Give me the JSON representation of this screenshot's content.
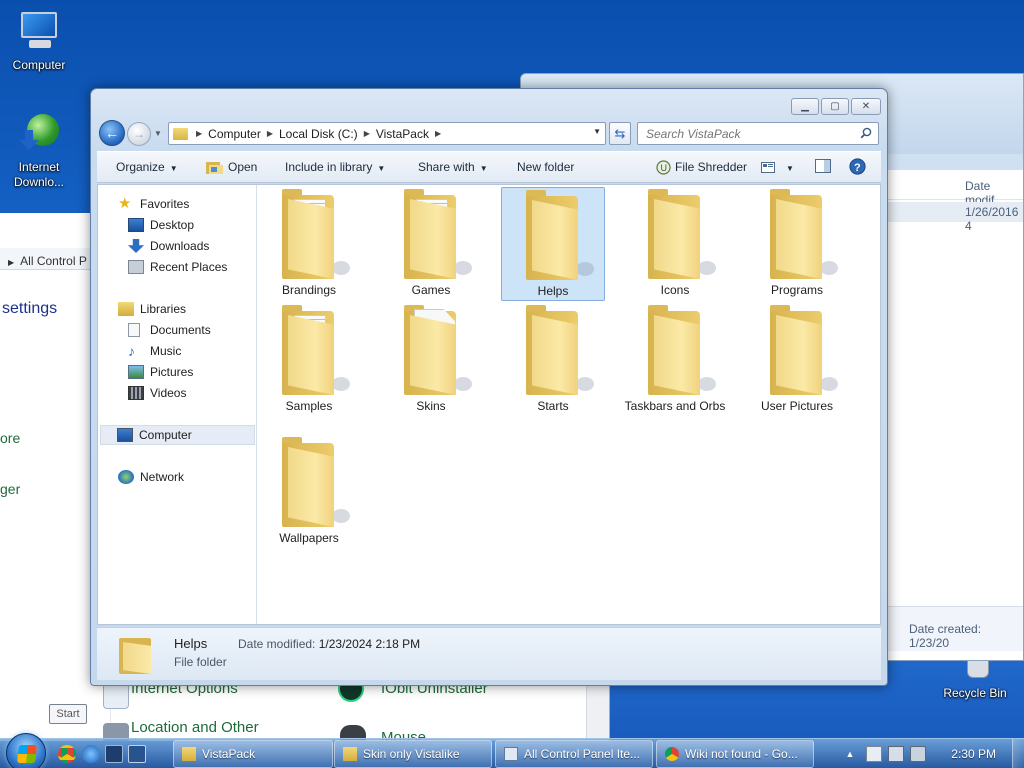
{
  "desktop": {
    "icons": [
      {
        "label": "Computer"
      },
      {
        "label": "Internet Downlo..."
      },
      {
        "label": "Recycle Bin"
      }
    ]
  },
  "control_panel": {
    "address_text": "All Control P",
    "settings_heading": "settings",
    "side_links": [
      "ore",
      "ger"
    ],
    "items": [
      "Internet Options",
      "IObit Uninstaller",
      "Location and Other",
      "Mouse"
    ]
  },
  "bg_window": {
    "column_header": "Date modif",
    "row_value": "1/26/2016 4",
    "footer_text": "Date created: 1/23/20"
  },
  "explorer": {
    "breadcrumbs": [
      "Computer",
      "Local Disk (C:)",
      "VistaPack"
    ],
    "search_placeholder": "Search VistaPack",
    "toolbar": {
      "organize": "Organize",
      "open": "Open",
      "include_in_library": "Include in library",
      "share_with": "Share with",
      "new_folder": "New folder",
      "file_shredder": "File Shredder"
    },
    "nav": {
      "favorites": "Favorites",
      "desktop": "Desktop",
      "downloads": "Downloads",
      "recent_places": "Recent Places",
      "libraries": "Libraries",
      "documents": "Documents",
      "music": "Music",
      "pictures": "Pictures",
      "videos": "Videos",
      "computer": "Computer",
      "network": "Network"
    },
    "folders": [
      {
        "name": "Brandings",
        "style": "papers"
      },
      {
        "name": "Games",
        "style": "papers"
      },
      {
        "name": "Helps",
        "style": "plain",
        "selected": true
      },
      {
        "name": "Icons",
        "style": "plain"
      },
      {
        "name": "Programs",
        "style": "plain"
      },
      {
        "name": "Samples",
        "style": "papers"
      },
      {
        "name": "Skins",
        "style": "white"
      },
      {
        "name": "Starts",
        "style": "plain"
      },
      {
        "name": "Taskbars and Orbs",
        "style": "plain"
      },
      {
        "name": "User Pictures",
        "style": "plain"
      },
      {
        "name": "Wallpapers",
        "style": "plain"
      }
    ],
    "details": {
      "name": "Helps",
      "type": "File folder",
      "date_label": "Date modified:",
      "date_value": "1/23/2024 2:18 PM"
    }
  },
  "tooltip": "Start",
  "taskbar": {
    "buttons": [
      "VistaPack",
      "Skin only Vistalike",
      "All Control Panel Ite...",
      "Wiki not found - Go..."
    ],
    "clock": "2:30 PM"
  },
  "colors": {
    "accent": "#1e63bf",
    "selection": "#cde3f8",
    "link_green": "#1e6b3a"
  }
}
